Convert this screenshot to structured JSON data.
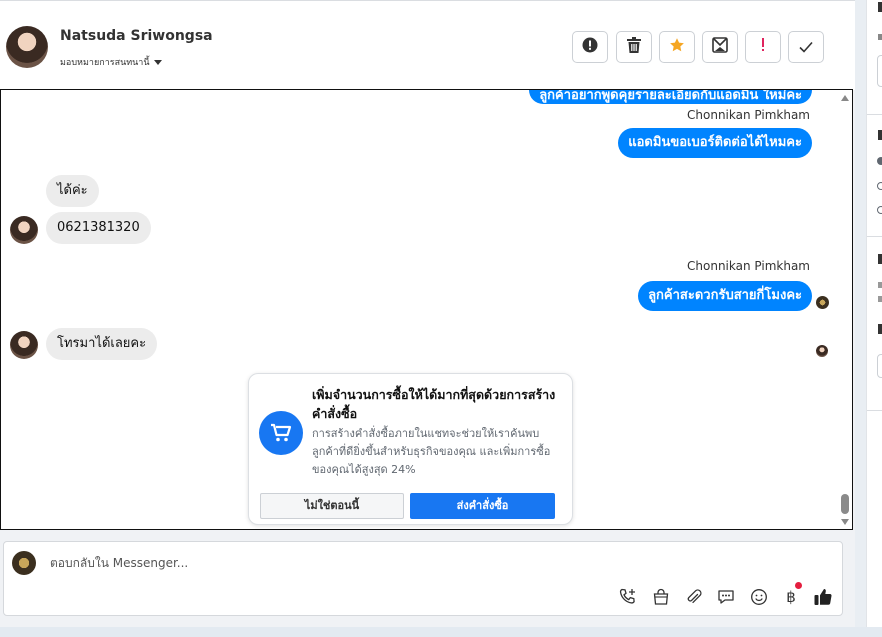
{
  "header": {
    "contact_name": "Natsuda Sriwongsa",
    "assign_label": "มอบหมายการสนทนานี้",
    "toolbar": [
      {
        "icon": "alert-circle-icon"
      },
      {
        "icon": "trash-icon"
      },
      {
        "icon": "star-icon",
        "color": "#f5a623"
      },
      {
        "icon": "archive-mail-icon"
      },
      {
        "icon": "exclamation-icon",
        "color": "#e0245e"
      },
      {
        "icon": "check-icon"
      }
    ]
  },
  "messages": {
    "top_partial": "ลูกค้าอยากพูดคุยรายละเอียดกับแอดมิน ใหม่คะ",
    "sender_1": "Chonnikan Pimkham",
    "out_1": "แอดมินขอเบอร์ติดต่อได้ไหมคะ",
    "in_1": "ได้ค่ะ",
    "in_2": "0621381320",
    "sender_2": "Chonnikan Pimkham",
    "out_2": "ลูกค้าสะดวกรับสายกี่โมงคะ",
    "in_3": "โทรมาได้เลยคะ"
  },
  "promo_card": {
    "title": "เพิ่มจำนวนการซื้อให้ได้มากที่สุดด้วยการสร้างคำสั่งซื้อ",
    "description": "การสร้างคำสั่งซื้อภายในแชทจะช่วยให้เราค้นพบลูกค้าที่ดียิ่งขึ้นสำหรับธุรกิจของคุณ และเพิ่มการซื้อของคุณได้สูงสุด 24%",
    "dismiss_label": "ไม่ใช่ตอนนี้",
    "primary_label": "ส่งคำสั่งซื้อ",
    "icon": "cart-icon"
  },
  "composer": {
    "placeholder": "ตอบกลับใน Messenger...",
    "icons": [
      "phone-plus-icon",
      "shopping-bag-icon",
      "paperclip-icon",
      "chat-bubble-icon",
      "emoji-icon",
      "baht-icon",
      "thumbs-up-icon"
    ]
  },
  "colors": {
    "accent": "#1877f2",
    "bubble_out": "#0084ff",
    "bubble_in": "#ececec"
  }
}
